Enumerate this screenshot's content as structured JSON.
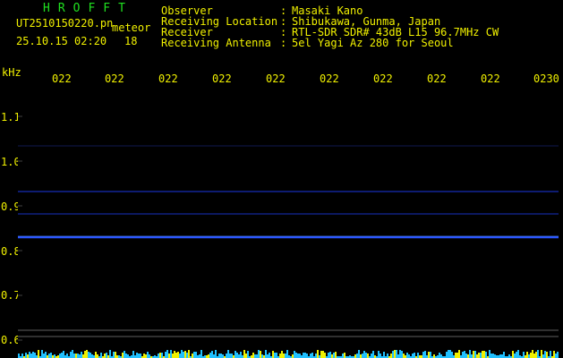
{
  "header": {
    "title": "HROFFT",
    "filename": "UT2510150220.pn",
    "meteor_label": "meteor",
    "datetime": "25.10.15 02:20",
    "count": "18"
  },
  "info": [
    {
      "label": "Observer",
      "value": "Masaki Kano"
    },
    {
      "label": "Receiving Location",
      "value": "Shibukawa, Gunma, Japan"
    },
    {
      "label": "Receiver",
      "value": "RTL-SDR SDR# 43dB L15 96.7MHz CW"
    },
    {
      "label": "Receiving Antenna",
      "value": "5el Yagi Az 280 for Seoul"
    }
  ],
  "separator": ":",
  "axis": {
    "y_unit": "kHz",
    "x_ticks": [
      "022",
      "022",
      "022",
      "022",
      "022",
      "022",
      "022",
      "022",
      "022",
      "0230"
    ],
    "y_ticks": [
      "1.1",
      "1.0",
      "0.9",
      "0.8",
      "0.7",
      "0.6"
    ]
  },
  "colors": {
    "text": "#f0f000",
    "title": "#20e020",
    "background": "#000000",
    "trace": "#2040ff",
    "noise": "#20c0ff"
  }
}
